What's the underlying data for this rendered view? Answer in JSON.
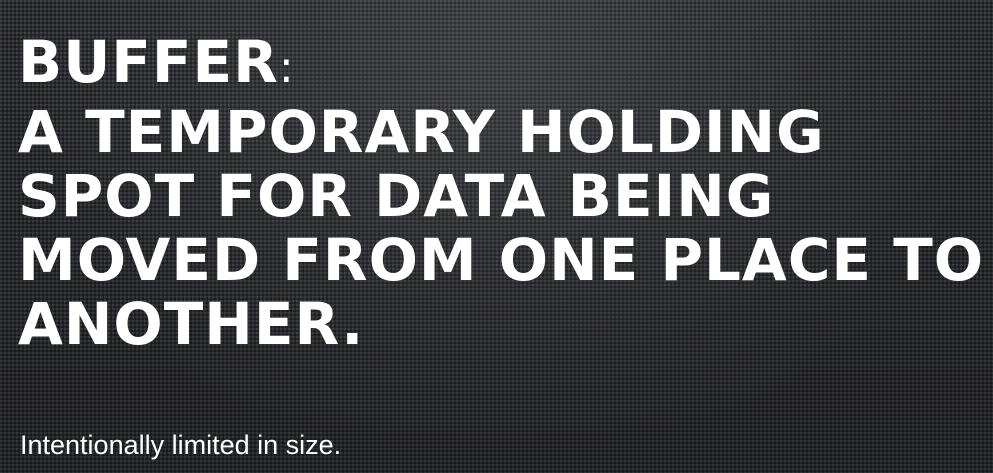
{
  "slide": {
    "term": "BUFFER",
    "colon": ":",
    "definition_lines": [
      "A TEMPORARY HOLDING",
      "SPOT FOR DATA BEING",
      "MOVED FROM ONE PLACE TO",
      "ANOTHER."
    ],
    "subtitle": "Intentionally limited in size.",
    "colors": {
      "background": "#2a2b2f",
      "text": "#ffffff"
    }
  }
}
